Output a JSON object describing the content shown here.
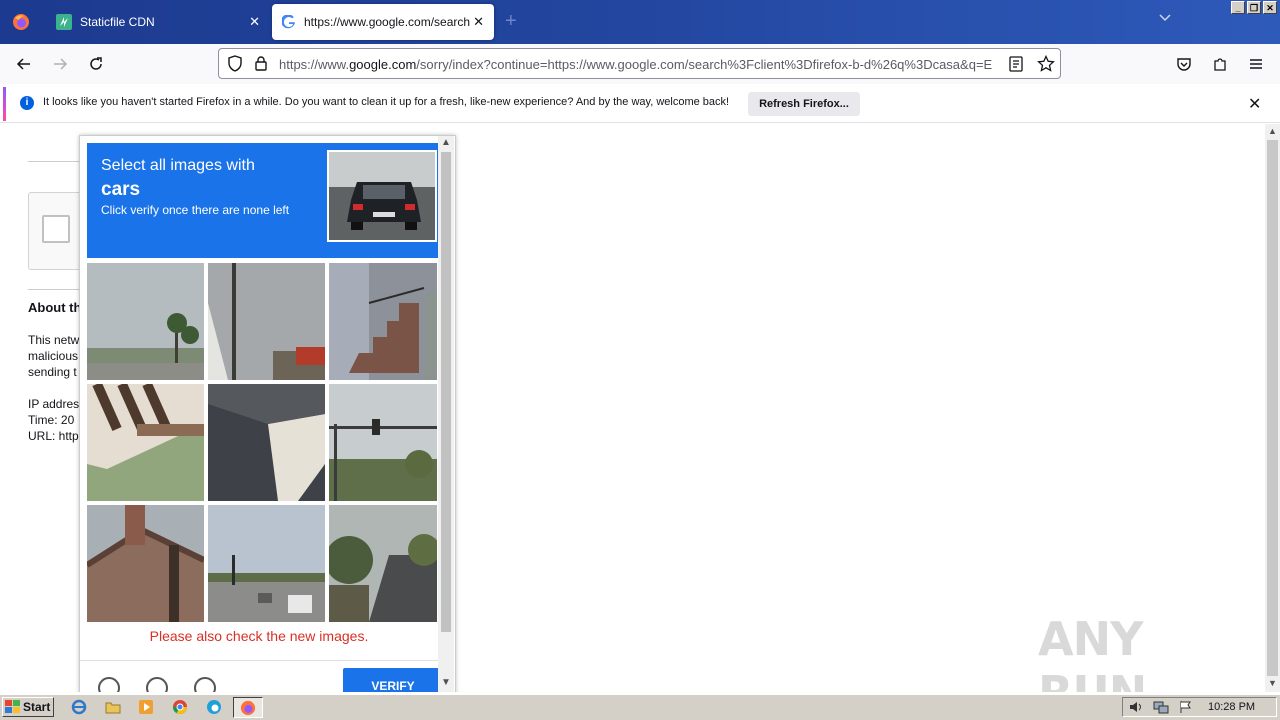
{
  "browser": {
    "tabs": [
      {
        "title": "Staticfile CDN",
        "favicon": "staticfile-icon"
      },
      {
        "title": "https://www.google.com/search?c",
        "favicon": "google-icon",
        "active": true
      }
    ],
    "new_tab_label": "+",
    "url": {
      "prefix": "https://www.",
      "domain": "google.com",
      "rest": "/sorry/index?continue=https://www.google.com/search%3Fclient%3Dfirefox-b-d%26q%3Dcasa&q=E"
    }
  },
  "notification": {
    "message": "It looks like you haven't started Firefox in a while. Do you want to clean it up for a fresh, like-new experience? And by the way, welcome back!",
    "button": "Refresh Firefox..."
  },
  "page": {
    "about_heading": "About th",
    "para1": [
      "This netw",
      "malicious",
      "sending t"
    ],
    "para2": [
      "IP addres",
      "Time: 20",
      "URL: http"
    ]
  },
  "captcha": {
    "instruction_line1": "Select all images with",
    "target": "cars",
    "instruction_line3": "Click verify once there are none left",
    "error": "Please also check the new images.",
    "verify_label": "VERIFY",
    "tiles": [
      "road-palms",
      "power-pole",
      "stairs",
      "wood-beams",
      "dark-roof",
      "traffic-light",
      "house",
      "intersection-cars",
      "street-trees"
    ]
  },
  "watermark": "ANY RUN",
  "taskbar": {
    "start_label": "Start",
    "clock": "10:28 PM"
  }
}
